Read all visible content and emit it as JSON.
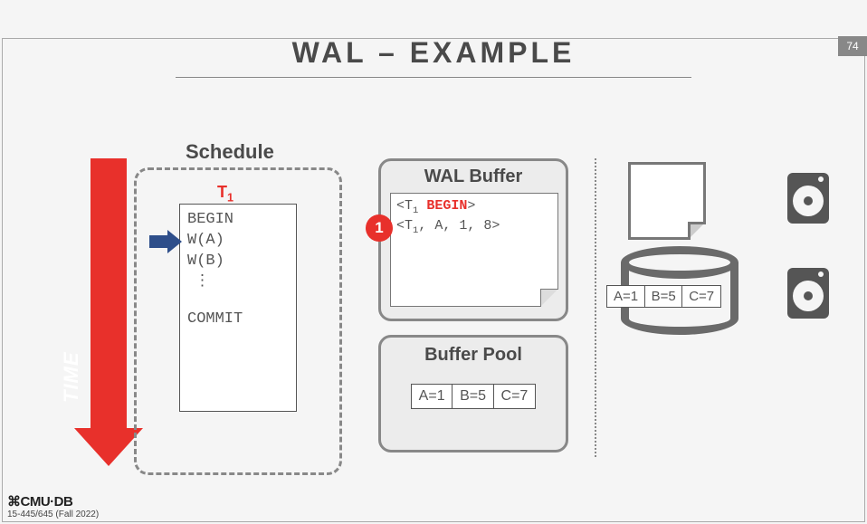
{
  "page_number": "74",
  "title": "WAL – EXAMPLE",
  "time_label": "TIME",
  "schedule": {
    "label": "Schedule",
    "txn_label_prefix": "T",
    "txn_label_sub": "1",
    "lines": {
      "begin": "BEGIN",
      "wa": "W(A)",
      "wb": "W(B)",
      "dots": "⋮",
      "commit": "COMMIT"
    }
  },
  "wal_buffer": {
    "title": "WAL Buffer",
    "line1_open": "<T",
    "line1_sub": "1",
    "line1_space": " ",
    "line1_begin": "BEGIN",
    "line1_close": ">",
    "line2_open": "<T",
    "line2_sub": "1",
    "line2_rest": ", A, 1, 8>",
    "badge": "1"
  },
  "buffer_pool": {
    "title": "Buffer Pool",
    "cells": {
      "a": "A=1",
      "b": "B=5",
      "c": "C=7"
    }
  },
  "disk_db": {
    "cells": {
      "a": "A=1",
      "b": "B=5",
      "c": "C=7"
    }
  },
  "footer": {
    "logo": "⌘CMU·DB",
    "course": "15-445/645 (Fall 2022)"
  }
}
